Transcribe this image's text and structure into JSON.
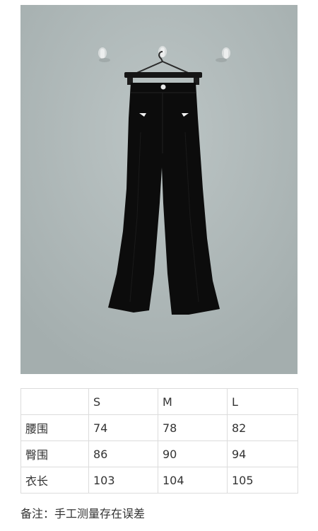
{
  "table": {
    "header": [
      "",
      "S",
      "M",
      "L"
    ],
    "rows": [
      {
        "label": "腰围",
        "values": [
          "74",
          "78",
          "82"
        ]
      },
      {
        "label": "臀围",
        "values": [
          "86",
          "90",
          "94"
        ]
      },
      {
        "label": "衣长",
        "values": [
          "103",
          "104",
          "105"
        ]
      }
    ]
  },
  "note": "备注：手工测量存在误差",
  "colors": {
    "wall": "#b3bcbc",
    "garment": "#0c0c0c",
    "grid_line": "#dcdcdc"
  }
}
